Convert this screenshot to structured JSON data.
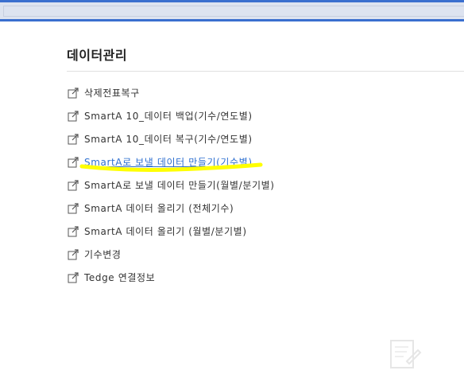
{
  "section": {
    "title": "데이터관리"
  },
  "menu": {
    "items": [
      {
        "label": "삭제전표복구",
        "icon": "external-link-icon",
        "active": false
      },
      {
        "label": "SmartA 10_데이터 백업(기수/연도별)",
        "icon": "external-link-icon",
        "active": false
      },
      {
        "label": "SmartA 10_데이터 복구(기수/연도별)",
        "icon": "external-link-icon",
        "active": false
      },
      {
        "label": "SmartA로 보낼 데이터 만들기(기수별)",
        "icon": "external-link-icon",
        "active": true
      },
      {
        "label": "SmartA로 보낼 데이터 만들기(월별/분기별)",
        "icon": "external-link-icon",
        "active": false
      },
      {
        "label": "SmartA 데이터 올리기 (전체기수)",
        "icon": "external-link-icon",
        "active": false
      },
      {
        "label": "SmartA 데이터 올리기 (월별/분기별)",
        "icon": "external-link-icon",
        "active": false
      },
      {
        "label": "기수변경",
        "icon": "external-link-icon",
        "active": false
      },
      {
        "label": "Tedge 연결정보",
        "icon": "external-link-icon",
        "active": false
      }
    ]
  },
  "colors": {
    "accent_bar": "#3a6fcf",
    "link_active": "#2e6fd0",
    "highlight": "#ffff00"
  }
}
